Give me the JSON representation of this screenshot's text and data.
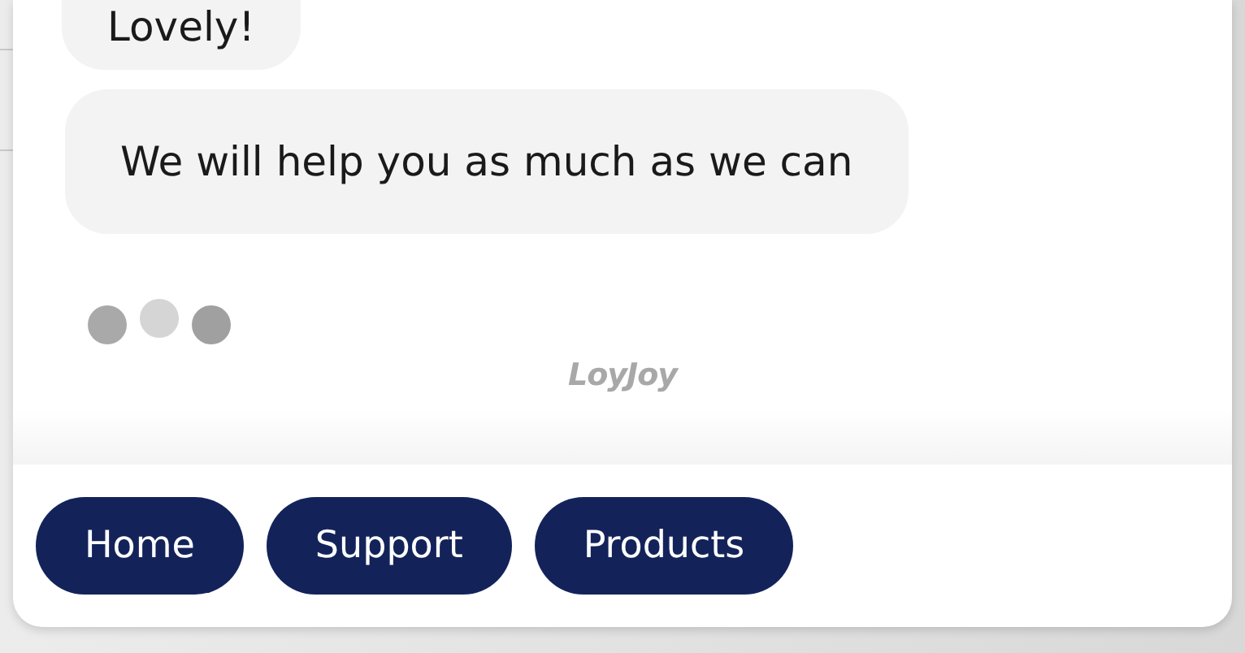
{
  "messages": [
    {
      "text": "Lovely!"
    },
    {
      "text": "We will help you as much as we can"
    }
  ],
  "typing": true,
  "brand": "LoyJoy",
  "buttons": [
    "Home",
    "Support",
    "Products"
  ]
}
